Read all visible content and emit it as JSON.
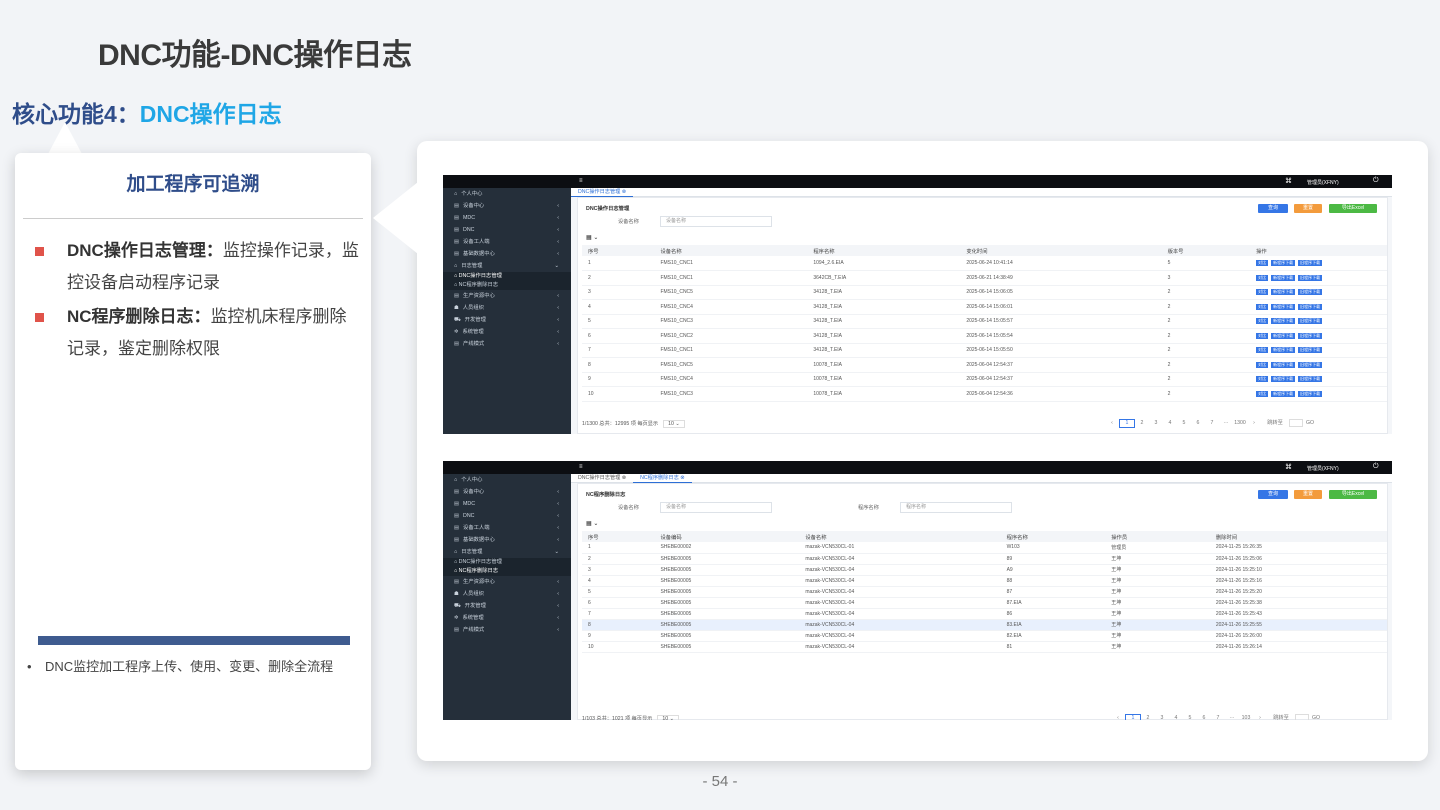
{
  "title": "DNC功能-DNC操作日志",
  "subtitle_prefix": "核心功能4：",
  "subtitle_highlight": "DNC操作日志",
  "left_card": {
    "heading": "加工程序可追溯",
    "bullets": [
      {
        "bold": "DNC操作日志管理：",
        "text": "监控操作记录，监控设备启动程序记录"
      },
      {
        "bold": "NC程序删除日志：",
        "text": "监控机床程序删除记录，鉴定删除权限"
      }
    ],
    "note_bullet": "•",
    "note": "DNC监控加工程序上传、使用、变更、删除全流程"
  },
  "page_number": "- 54 -",
  "screens": [
    {
      "topbar": {
        "menu_icon": "≡",
        "user": "管理员(XFNY)"
      },
      "tabs": [
        {
          "label": "DNC操作日志管理 ⊗",
          "active": true
        }
      ],
      "panel_title": "DNC操作日志管理",
      "filters": [
        {
          "label": "设备名称",
          "placeholder": "设备名称"
        }
      ],
      "buttons": {
        "query": "查询",
        "reset": "重置",
        "export": "导出Excel"
      },
      "toolbar_icon": "▦ ⌄",
      "columns": [
        "序号",
        "设备名称",
        "程序名称",
        "变化时间",
        "版本号",
        "操作"
      ],
      "row_actions": [
        "对比",
        "新程序下载",
        "旧程序下载"
      ],
      "rows": [
        [
          "1",
          "FMS10_CNC1",
          "1094_2.6.EIA",
          "2025-06-24 10:41:14",
          "5"
        ],
        [
          "2",
          "FMS10_CNC1",
          "3642CB_T.EIA",
          "2025-06-21 14:38:49",
          "3"
        ],
        [
          "3",
          "FMS10_CNC5",
          "34128_T.EIA",
          "2025-06-14 15:06:05",
          "2"
        ],
        [
          "4",
          "FMS10_CNC4",
          "34128_T.EIA",
          "2025-06-14 15:06:01",
          "2"
        ],
        [
          "5",
          "FMS10_CNC3",
          "34128_T.EIA",
          "2025-06-14 15:05:57",
          "2"
        ],
        [
          "6",
          "FMS10_CNC2",
          "34128_T.EIA",
          "2025-06-14 15:05:54",
          "2"
        ],
        [
          "7",
          "FMS10_CNC1",
          "34128_T.EIA",
          "2025-06-14 15:05:50",
          "2"
        ],
        [
          "8",
          "FMS10_CNC5",
          "10078_T.EIA",
          "2025-06-04 12:54:37",
          "2"
        ],
        [
          "9",
          "FMS10_CNC4",
          "10078_T.EIA",
          "2025-06-04 12:54:37",
          "2"
        ],
        [
          "10",
          "FMS10_CNC3",
          "10078_T.EIA",
          "2025-06-04 12:54:36",
          "2"
        ]
      ],
      "pagination": {
        "summary": "1/1300 总共：12995 项  每页显示",
        "page_size": "10 ⌄",
        "pages": [
          "‹",
          "1",
          "2",
          "3",
          "4",
          "5",
          "6",
          "7",
          "···",
          "1300",
          "›"
        ],
        "goto": "跳转至",
        "go": "GO"
      }
    },
    {
      "topbar": {
        "menu_icon": "≡",
        "user": "管理员(XFNY)"
      },
      "tabs": [
        {
          "label": "DNC操作日志管理 ⊗",
          "active": false
        },
        {
          "label": "NC程序删除日志 ⊗",
          "active": true
        }
      ],
      "panel_title": "NC程序删除日志",
      "filters": [
        {
          "label": "设备名称",
          "placeholder": "设备名称"
        },
        {
          "label": "程序名称",
          "placeholder": "程序名称"
        }
      ],
      "buttons": {
        "query": "查询",
        "reset": "重置",
        "export": "导出Excel"
      },
      "toolbar_icon": "▦ ⌄",
      "columns": [
        "序号",
        "设备编码",
        "设备名称",
        "程序名称",
        "操作员",
        "删除时间"
      ],
      "rows": [
        [
          "1",
          "SHEBE00002",
          "mazak-VCN530CL-01",
          "W103",
          "管理员",
          "2024-11-25 15:26:35"
        ],
        [
          "2",
          "SHEBE00005",
          "mazak-VCN530CL-04",
          "89",
          "王坤",
          "2024-11-26 15:25:06"
        ],
        [
          "3",
          "SHEBE00005",
          "mazak-VCN530CL-04",
          "A9",
          "王坤",
          "2024-11-26 15:25:10"
        ],
        [
          "4",
          "SHEBE00005",
          "mazak-VCN530CL-04",
          "88",
          "王坤",
          "2024-11-26 15:25:16"
        ],
        [
          "5",
          "SHEBE00005",
          "mazak-VCN530CL-04",
          "87",
          "王坤",
          "2024-11-26 15:25:20"
        ],
        [
          "6",
          "SHEBE00005",
          "mazak-VCN530CL-04",
          "87.EIA",
          "王坤",
          "2024-11-26 15:25:38"
        ],
        [
          "7",
          "SHEBE00005",
          "mazak-VCN530CL-04",
          "86",
          "王坤",
          "2024-11-26 15:25:43"
        ],
        [
          "8",
          "SHEBE00005",
          "mazak-VCN530CL-04",
          "83.EIA",
          "王坤",
          "2024-11-26 15:25:55"
        ],
        [
          "9",
          "SHEBE00005",
          "mazak-VCN530CL-04",
          "82.EIA",
          "王坤",
          "2024-11-26 15:26:00"
        ],
        [
          "10",
          "SHEBE00005",
          "mazak-VCN530CL-04",
          "81",
          "王坤",
          "2024-11-26 15:26:14"
        ]
      ],
      "pagination": {
        "summary": "1/103 总共：1021 项  每页显示",
        "page_size": "10 ⌄",
        "pages": [
          "‹",
          "1",
          "2",
          "3",
          "4",
          "5",
          "6",
          "7",
          "···",
          "103",
          "›"
        ],
        "goto": "跳转至",
        "go": "GO"
      }
    }
  ],
  "sidebar_top": [
    {
      "icon": "⌂",
      "label": "个人中心",
      "arrow": ""
    },
    {
      "icon": "▤",
      "label": "设备中心",
      "arrow": "‹"
    },
    {
      "icon": "▤",
      "label": "MDC",
      "arrow": "‹"
    },
    {
      "icon": "▤",
      "label": "DNC",
      "arrow": "‹"
    },
    {
      "icon": "▤",
      "label": "设备工人端",
      "arrow": "‹"
    },
    {
      "icon": "▤",
      "label": "基础数据中心",
      "arrow": "‹"
    },
    {
      "icon": "⌂",
      "label": "日志管理",
      "arrow": "⌄"
    }
  ],
  "sidebar_subs_1": [
    "DNC操作日志管理",
    "NC程序删除日志"
  ],
  "sidebar_bottom": [
    {
      "icon": "▤",
      "label": "生产资源中心",
      "arrow": "‹"
    },
    {
      "icon": "☗",
      "label": "人员组织",
      "arrow": "‹"
    },
    {
      "icon": "⛟",
      "label": "开发管理",
      "arrow": "‹"
    },
    {
      "icon": "✲",
      "label": "系统管理",
      "arrow": "‹"
    },
    {
      "icon": "▤",
      "label": "产线模式",
      "arrow": "‹"
    }
  ],
  "colors": {
    "title_blue": "#2f4d8a",
    "highlight_blue": "#1fa6e6",
    "bullet_red": "#e0534a",
    "bar_blue": "#3e5b8f",
    "sidebar": "#252f3a"
  }
}
